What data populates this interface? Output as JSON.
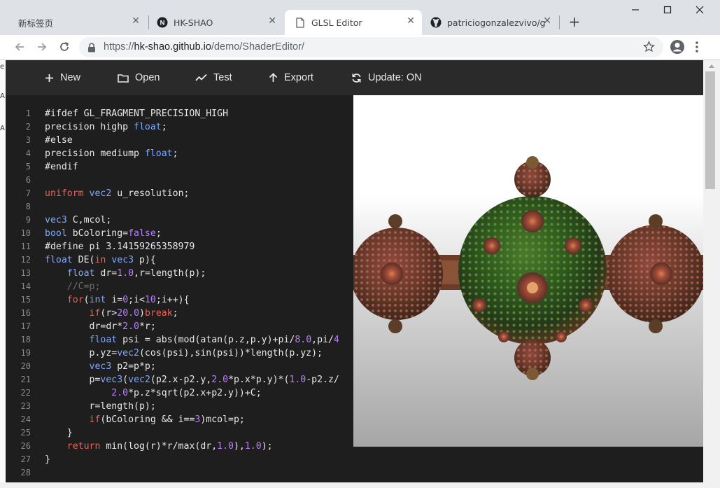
{
  "browser": {
    "tabs": [
      {
        "title": "新标签页",
        "icon": "none"
      },
      {
        "title": "HK-SHAO",
        "icon": "notion-n-icon"
      },
      {
        "title": "GLSL Editor",
        "icon": "page-icon",
        "active": true
      },
      {
        "title": "patriciogonzalezvivo/g",
        "icon": "github-icon"
      }
    ],
    "url_prefix": "https://",
    "url_host": "hk-shao.github.io",
    "url_path": "/demo/ShaderEditor/"
  },
  "background_fragments": [
    "e",
    "A",
    "A"
  ],
  "editor": {
    "menu": [
      {
        "label": "New",
        "icon": "plus-icon"
      },
      {
        "label": "Open",
        "icon": "folder-icon"
      },
      {
        "label": "Test",
        "icon": "trend-icon"
      },
      {
        "label": "Export",
        "icon": "arrow-up-icon"
      },
      {
        "label": "Update: ON",
        "icon": "refresh-icon"
      }
    ],
    "line_numbers": [
      "1",
      "2",
      "3",
      "4",
      "5",
      "6",
      "7",
      "8",
      "9",
      "10",
      "11",
      "12",
      "13",
      "14",
      "15",
      "16",
      "17",
      "18",
      "19",
      "20",
      "21",
      "22",
      "23",
      "24",
      "25",
      "26",
      "27",
      "28"
    ],
    "code_lines": [
      "#ifdef GL_FRAGMENT_PRECISION_HIGH",
      "precision highp float;",
      "#else",
      "precision mediump float;",
      "#endif",
      "",
      "uniform vec2 u_resolution;",
      "",
      "vec3 C,mcol;",
      "bool bColoring=false;",
      "#define pi 3.14159265358979",
      "float DE(in vec3 p){",
      "    float dr=1.0,r=length(p);",
      "    //C=p;",
      "    for(int i=0;i<10;i++){",
      "        if(r>20.0)break;",
      "        dr=dr*2.0*r;",
      "        float psi = abs(mod(atan(p.z,p.y)+pi/8.0,pi/4",
      "        p.yz=vec2(cos(psi),sin(psi))*length(p.yz);",
      "        vec3 p2=p*p;",
      "        p=vec3(vec2(p2.x-p2.y,2.0*p.x*p.y)*(1.0-p2.z/",
      "            2.0*p.z*sqrt(p2.x+p2.y))+C;",
      "        r=length(p);",
      "        if(bColoring && i==3)mcol=p;",
      "    }",
      "    return min(log(r)*r/max(dr,1.0),1.0);",
      "}",
      ""
    ]
  },
  "colors": {
    "keyword": "#ef6155",
    "type": "#7fa8ff",
    "number": "#b87fff",
    "comment": "#6c6c6c"
  }
}
